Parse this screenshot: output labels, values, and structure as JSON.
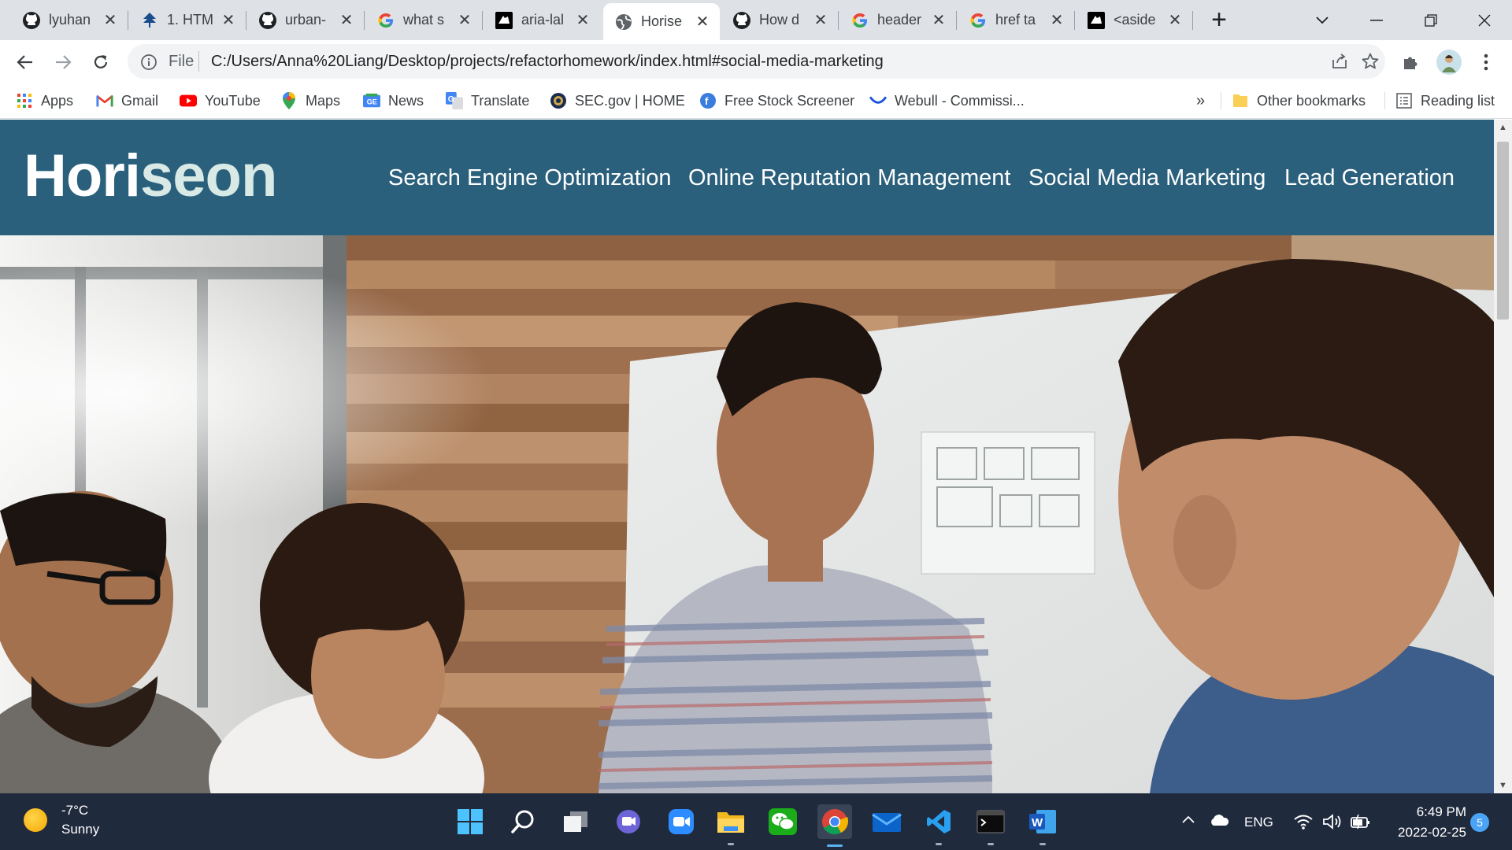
{
  "tabs": [
    {
      "title": "lyuhan",
      "icon": "github-icon"
    },
    {
      "title": "1. HTM",
      "icon": "tree-icon"
    },
    {
      "title": "urban-",
      "icon": "github-icon"
    },
    {
      "title": "what s",
      "icon": "google-icon"
    },
    {
      "title": "aria-lal",
      "icon": "mdn-icon"
    },
    {
      "title": "Horise",
      "icon": "globe-icon",
      "active": true
    },
    {
      "title": "How d",
      "icon": "github-icon"
    },
    {
      "title": "header",
      "icon": "google-icon"
    },
    {
      "title": "href ta",
      "icon": "google-icon"
    },
    {
      "title": "<aside",
      "icon": "mdn-icon"
    }
  ],
  "address_bar": {
    "scheme_label": "File",
    "url": "C:/Users/Anna%20Liang/Desktop/projects/refactorhomework/index.html#social-media-marketing"
  },
  "bookmarks": [
    {
      "label": "Apps",
      "icon": "apps-grid-icon"
    },
    {
      "label": "Gmail",
      "icon": "gmail-icon"
    },
    {
      "label": "YouTube",
      "icon": "youtube-icon"
    },
    {
      "label": "Maps",
      "icon": "maps-pin-icon"
    },
    {
      "label": "News",
      "icon": "news-icon"
    },
    {
      "label": "Translate",
      "icon": "translate-icon"
    },
    {
      "label": "SEC.gov | HOME",
      "icon": "sec-seal-icon"
    },
    {
      "label": "Free Stock Screener",
      "icon": "finviz-icon"
    },
    {
      "label": "Webull - Commissi...",
      "icon": "webull-icon"
    }
  ],
  "bookmarks_overflow": "»",
  "other_bookmarks": "Other bookmarks",
  "reading_list": "Reading list",
  "site": {
    "logo_main": "Hori",
    "logo_accent": "seon",
    "nav": [
      "Search Engine Optimization",
      "Online Reputation Management",
      "Social Media Marketing",
      "Lead Generation"
    ],
    "header_color": "#2a607c"
  },
  "taskbar": {
    "weather_temp": "-7°C",
    "weather_condition": "Sunny",
    "language": "ENG",
    "time": "6:49 PM",
    "date": "2022-02-25",
    "notification_count": "5",
    "apps": [
      "windows-start-icon",
      "search-icon",
      "task-view-icon",
      "teams-chat-icon",
      "zoom-icon",
      "file-explorer-icon",
      "wechat-icon",
      "chrome-icon",
      "mail-icon",
      "vscode-icon",
      "terminal-icon",
      "word-icon"
    ]
  }
}
